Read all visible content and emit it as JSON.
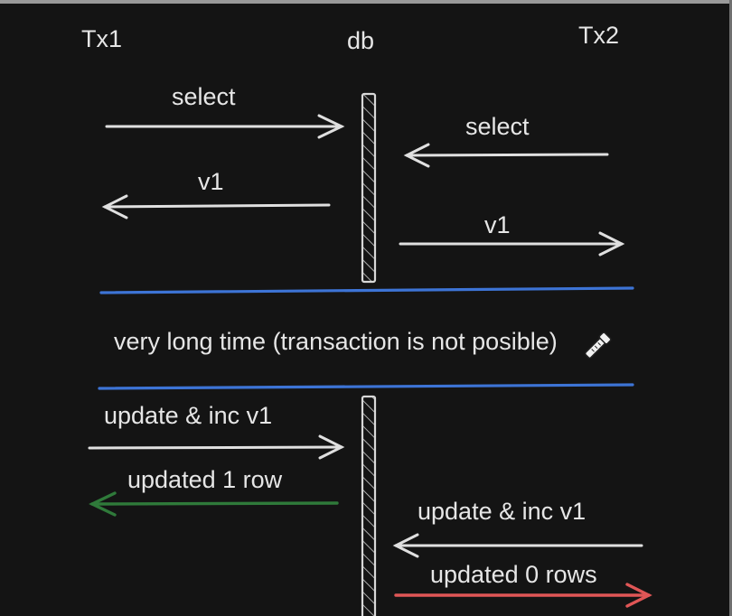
{
  "participants": {
    "left": "Tx1",
    "center": "db",
    "right": "Tx2"
  },
  "phase1": {
    "tx1_request": "select",
    "tx1_response": "v1",
    "tx2_request": "select",
    "tx2_response": "v1"
  },
  "separator": {
    "text": "very long time (transaction is not posible)"
  },
  "phase2": {
    "tx1_request": "update & inc v1",
    "tx1_response": "updated 1 row",
    "tx2_request": "update & inc v1",
    "tx2_response": "updated 0 rows"
  },
  "colors": {
    "arrow": "#e0e0e0",
    "separator_line": "#3d74d6",
    "success_arrow": "#2f7a3a",
    "failure_arrow": "#e05656",
    "db_bar": "#d8d8d8"
  },
  "icons": {
    "cursor": "eyedropper-cursor-icon"
  }
}
